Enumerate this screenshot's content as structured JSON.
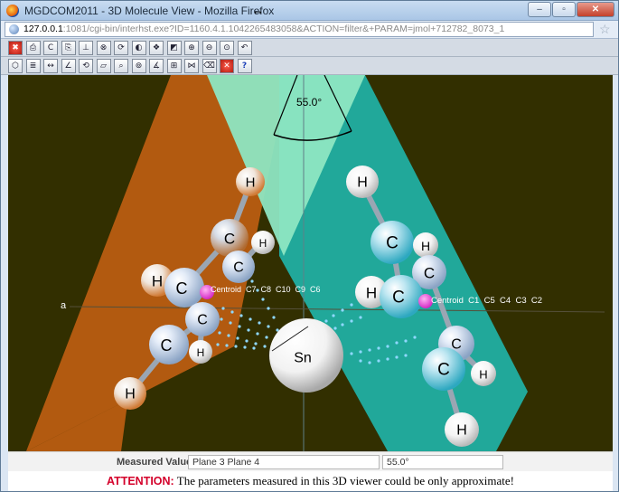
{
  "window": {
    "title": "MGDCOM2011 - 3D Molecule View - Mozilla Firefox",
    "minimize_label": "–",
    "maximize_label": "▫",
    "close_label": "✕"
  },
  "address": {
    "url_host": "127.0.0.1",
    "url_rest": ":1081/cgi-bin/interhst.exe?ID=1160.4.1.1042265483058&ACTION=filter&+PARAM=jmol+712782_8073_1"
  },
  "toolbar1": {
    "icons": [
      "close-icon",
      "print-icon",
      "copy-icon",
      "paste-icon",
      "center-icon",
      "rotate-icon",
      "color-icon",
      "spin-icon",
      "view-icon",
      "image-icon",
      "zoom-in-icon",
      "zoom-out-icon",
      "reset-icon",
      "undo-icon"
    ],
    "glyphs": [
      "✖",
      "⎙",
      "C",
      "⎘",
      "⊥",
      "⊗",
      "⟳",
      "◐",
      "❖",
      "◩",
      "⊕",
      "⊖",
      "⊙",
      "↶"
    ]
  },
  "toolbar2": {
    "icons": [
      "atom-icon",
      "labels-icon",
      "distance-icon",
      "angle-icon",
      "torsion-icon",
      "plane-icon",
      "measure-icon",
      "centroid-icon",
      "plane-angle-icon",
      "plane-distance-icon",
      "hbond-icon",
      "eraser-icon",
      "clear-icon",
      "help-icon"
    ],
    "glyphs": [
      "⬡",
      "≣",
      "↔",
      "∠",
      "⟲",
      "▱",
      "⌕",
      "⊚",
      "∡",
      "⊞",
      "⋈",
      "⌫",
      "✕",
      "?"
    ]
  },
  "viewer": {
    "angle_label": "55.0°",
    "axis_label": "a",
    "atoms": {
      "h1": "H",
      "h2": "H",
      "h3": "H",
      "h4": "H",
      "h5": "H",
      "h6": "H",
      "h7": "H",
      "h8": "H",
      "h9": "H",
      "h10": "H",
      "c1": "C",
      "c2": "C",
      "c3": "C",
      "c4": "C",
      "c5": "C",
      "c6": "C",
      "c7": "C",
      "c8": "C",
      "c9": "C",
      "c10": "C",
      "sn": "Sn"
    },
    "centroid_left": "Centroid  C7  C8  C10  C9  C6",
    "centroid_right": "Centroid  C1  C5  C4  C3  C2",
    "colors": {
      "plane_left": "#b25a10",
      "plane_right": "#21a89a",
      "plane_top": "#8ee6c2",
      "background": "#322f00"
    }
  },
  "measure": {
    "label": "Measured Values",
    "planes_value": "Plane 3 Plane 4",
    "angle_value": "55.0°"
  },
  "attention": {
    "label": "ATTENTION:",
    "message": " The parameters measured in this 3D viewer could be only approximate!"
  }
}
